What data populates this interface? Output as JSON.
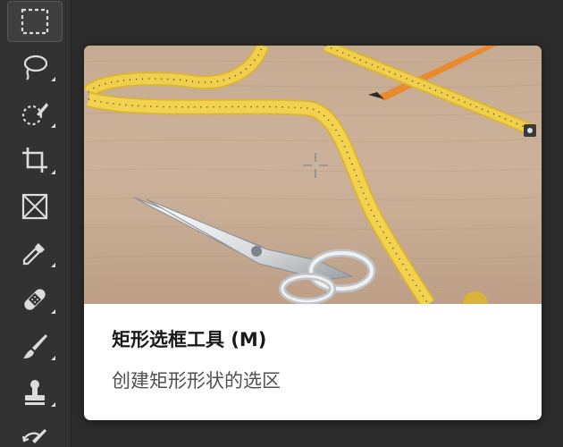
{
  "toolbar": {
    "tools": [
      {
        "name": "rectangular-marquee",
        "icon": "marquee-icon",
        "active": true
      },
      {
        "name": "lasso",
        "icon": "lasso-icon"
      },
      {
        "name": "quick-selection",
        "icon": "quick-selection-icon"
      },
      {
        "name": "crop",
        "icon": "crop-icon"
      },
      {
        "name": "frame",
        "icon": "frame-icon"
      },
      {
        "name": "eyedropper",
        "icon": "eyedropper-icon"
      },
      {
        "name": "healing-brush",
        "icon": "bandage-icon"
      },
      {
        "name": "brush",
        "icon": "brush-icon"
      },
      {
        "name": "clone-stamp",
        "icon": "stamp-icon"
      },
      {
        "name": "history-brush",
        "icon": "history-brush-icon"
      }
    ]
  },
  "tooltip": {
    "title": "矩形选框工具 (M)",
    "description": "创建矩形形状的选区",
    "preview": {
      "subject": "scissors, measuring tape and pencil on wood"
    }
  },
  "colors": {
    "toolbar_bg": "#323232",
    "app_bg": "#2b2b2b",
    "icon": "#dcdcdc",
    "tape": "#e8c43a"
  }
}
